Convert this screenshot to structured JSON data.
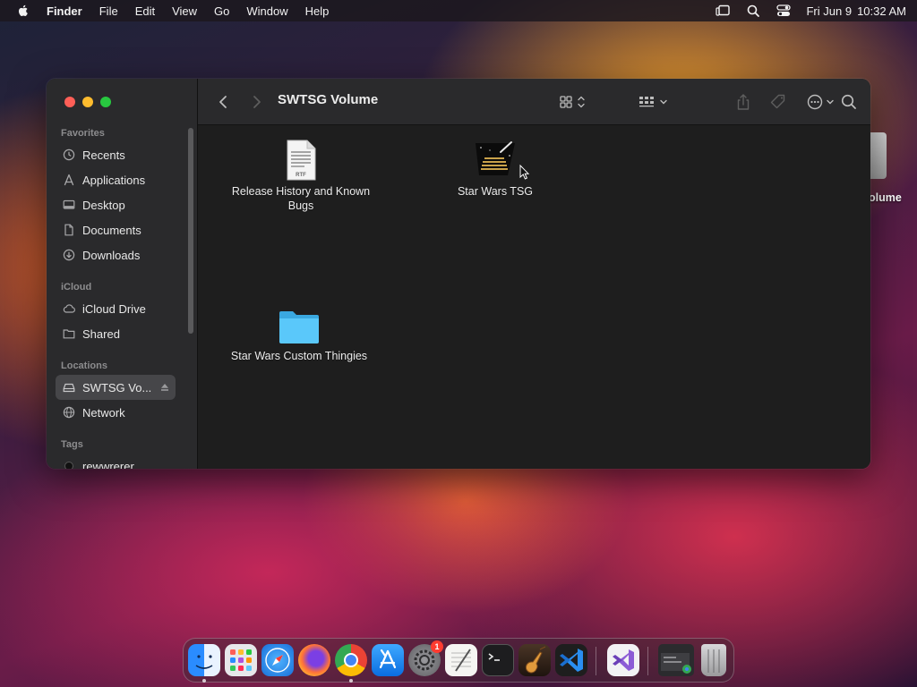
{
  "menubar": {
    "app_name": "Finder",
    "menus": [
      "File",
      "Edit",
      "View",
      "Go",
      "Window",
      "Help"
    ],
    "clock_date": "Fri Jun 9",
    "clock_time": "10:32 AM",
    "status_icons": [
      "stage-manager-icon",
      "spotlight-search-icon",
      "control-center-icon"
    ]
  },
  "desktop": {
    "volume_label_visible": "olume"
  },
  "window": {
    "title": "SWTSG Volume",
    "sidebar": {
      "favorites_header": "Favorites",
      "favorites": [
        {
          "label": "Recents",
          "icon": "clock-icon"
        },
        {
          "label": "Applications",
          "icon": "applications-icon"
        },
        {
          "label": "Desktop",
          "icon": "desktop-icon"
        },
        {
          "label": "Documents",
          "icon": "document-icon"
        },
        {
          "label": "Downloads",
          "icon": "download-icon"
        }
      ],
      "icloud_header": "iCloud",
      "icloud": [
        {
          "label": "iCloud Drive",
          "icon": "cloud-icon"
        },
        {
          "label": "Shared",
          "icon": "shared-folder-icon"
        }
      ],
      "locations_header": "Locations",
      "locations": [
        {
          "label": "SWTSG Vo...",
          "icon": "drive-icon",
          "selected": true
        },
        {
          "label": "Network",
          "icon": "globe-icon"
        }
      ],
      "tags_header": "Tags",
      "tags": [
        {
          "label": "rewwrerer",
          "color": "#111111"
        }
      ]
    },
    "files": [
      {
        "name": "Release History and Known Bugs",
        "kind": "rtf-document",
        "badge": "RTF"
      },
      {
        "name": "Star Wars TSG",
        "kind": "application"
      },
      {
        "name": "Star Wars Custom Thingies",
        "kind": "folder",
        "color": "#5ac8fa"
      }
    ]
  },
  "dock": {
    "apps": [
      "Finder",
      "Launchpad",
      "Safari",
      "Firefox",
      "Google Chrome",
      "App Store",
      "System Settings",
      "TextEdit",
      "Terminal",
      "GarageBand",
      "Visual Studio Code",
      "Visual Studio",
      "Chrome Window",
      "Trash"
    ],
    "system_settings_badge": "1"
  }
}
